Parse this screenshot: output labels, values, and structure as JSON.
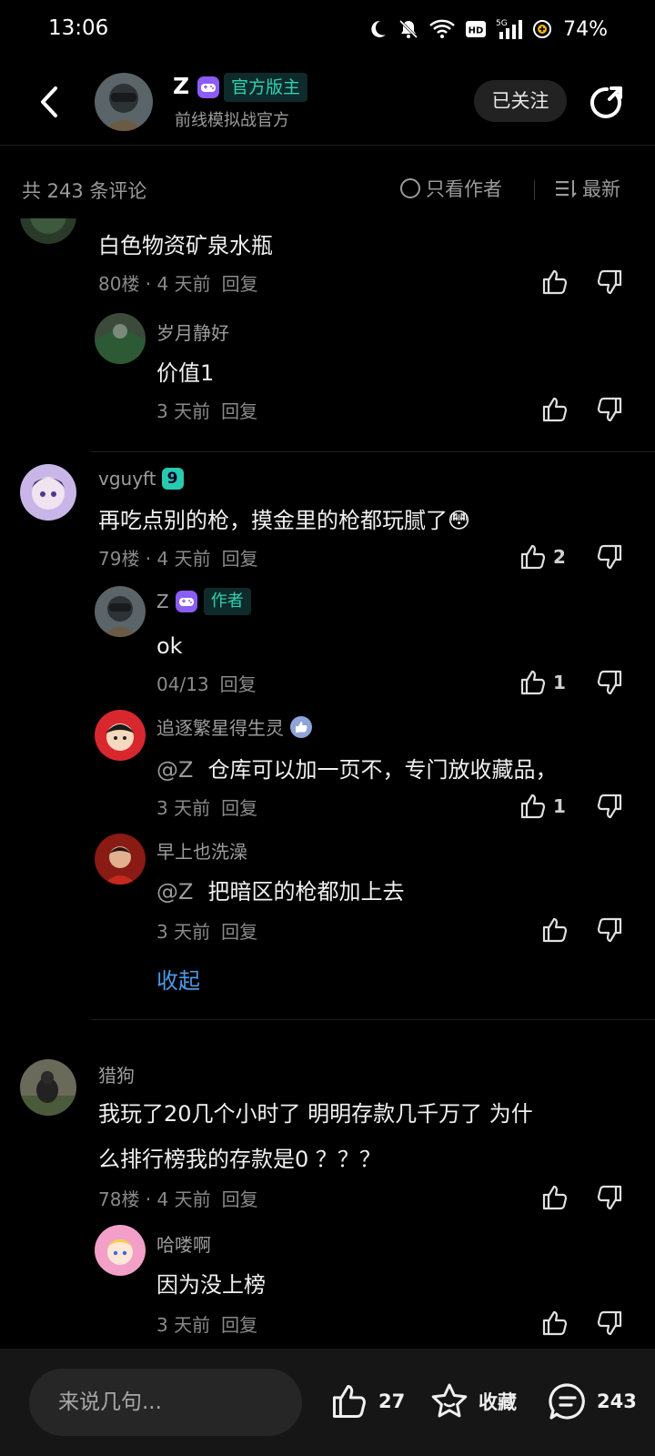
{
  "status": {
    "time": "13:06",
    "battery": "74%"
  },
  "header": {
    "name": "Z",
    "official_tag": "官方版主",
    "subtitle": "前线模拟战官方",
    "follow_label": "已关注"
  },
  "filter": {
    "count_label": "共 243 条评论",
    "author_only_label": "只看作者",
    "sort_label": "最新"
  },
  "comments": [
    {
      "text": "白色物资矿泉水瓶",
      "floor": "80楼",
      "time": "4 天前",
      "reply": "回复"
    },
    {
      "user": "岁月静好",
      "text": "价值1",
      "time": "3 天前",
      "reply": "回复"
    },
    {
      "user": "vguyft",
      "level": "9",
      "text": "再吃点别的枪，摸金里的枪都玩腻了",
      "emoji": "😳",
      "floor": "79楼",
      "time": "4 天前",
      "reply": "回复",
      "likes": "2"
    },
    {
      "user": "Z",
      "author_tag": "作者",
      "text": "ok",
      "time": "04/13",
      "reply": "回复",
      "likes": "1"
    },
    {
      "user": "追逐繁星得生灵",
      "mention": "@Z",
      "text": "仓库可以加一页不，专门放收藏品，",
      "time": "3 天前",
      "reply": "回复",
      "likes": "1"
    },
    {
      "user": "早上也洗澡",
      "mention": "@Z",
      "text": "把暗区的枪都加上去",
      "time": "3 天前",
      "reply": "回复"
    },
    {
      "collapse": "收起"
    },
    {
      "user": "猎狗",
      "text_line1": "我玩了20几个小时了 明明存款几千万了 为什",
      "text_line2": "么排行榜我的存款是0 ？？？",
      "floor": "78楼",
      "time": "4 天前",
      "reply": "回复"
    },
    {
      "user": "哈喽啊",
      "text": "因为没上榜",
      "time": "3 天前",
      "reply": "回复"
    }
  ],
  "bottom": {
    "input_placeholder": "来说几句...",
    "likes": "27",
    "favorite_label": "收藏",
    "comments": "243"
  },
  "colors": {
    "accent": "#2fd2b4",
    "link": "#4a9ae6",
    "background": "#000000"
  }
}
